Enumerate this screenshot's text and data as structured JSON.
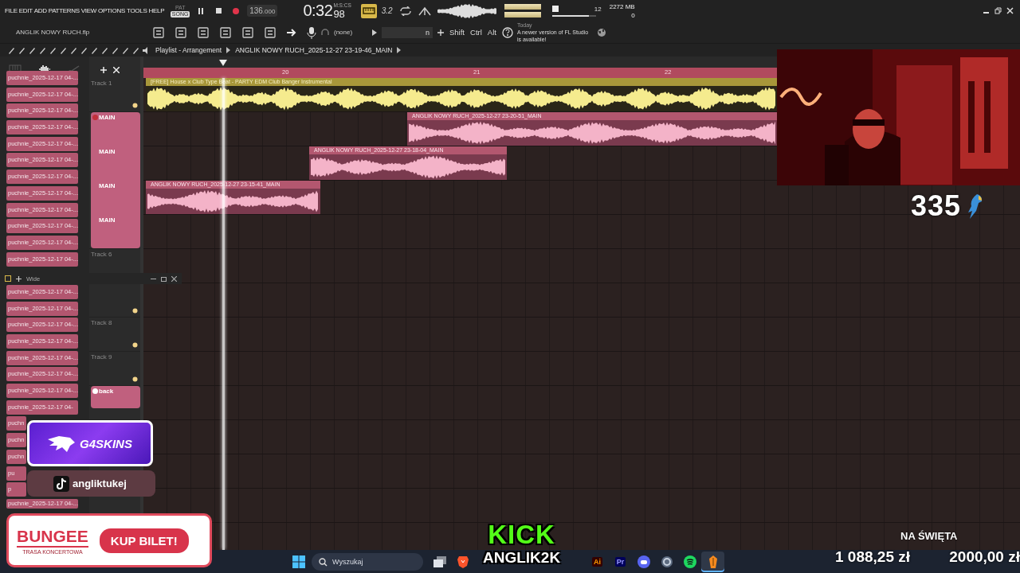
{
  "menu": [
    "FILE",
    "EDIT",
    "ADD",
    "PATTERNS",
    "VIEW",
    "OPTIONS",
    "TOOLS",
    "HELP"
  ],
  "mode_toggle": [
    {
      "label": "PAT",
      "selected": false
    },
    {
      "label": "SONG",
      "selected": true
    }
  ],
  "transport": {
    "recording": true,
    "tempo": "136",
    "tempo_fraction": ".000"
  },
  "time": {
    "unit": "M:S:CS",
    "value": "0:32",
    "fraction": "98"
  },
  "snap": "3.2",
  "monitor": {
    "voices": "12",
    "memory": "2272 MB",
    "polyphony": "0"
  },
  "master_volume": {
    "level": 0.85
  },
  "project_file": "ANGLIK NOWY RUCH.flp",
  "pattern_selector": "(none)",
  "name_field": "n",
  "modifier_keys": [
    "Shift",
    "Ctrl",
    "Alt"
  ],
  "news": {
    "label": "Today",
    "text": "A newer version of FL Studio is available!"
  },
  "playlist": {
    "title": "Playlist - Arrangement",
    "breadcrumb": "ANGLIK NOWY RUCH_2025-12-27 23-19-46_MAIN",
    "ruler": [
      "20",
      "21",
      "22"
    ]
  },
  "browser": {
    "tabs": [
      {
        "kind": "piano",
        "selected": false
      },
      {
        "kind": "audio",
        "selected": true
      },
      {
        "kind": "plugin",
        "selected": false
      }
    ],
    "items_top": [
      "puchnie_2025-12-17 04-...",
      "puchnie_2025-12-17 04-...",
      "puchnie_2025-12-17 04-...",
      "puchnie_2025-12-17 04-...",
      "puchnie_2025-12-17 04-...",
      "puchnie_2025-12-17 04-...",
      "puchnie_2025-12-17 04-...",
      "puchnie_2025-12-17 04-...",
      "puchnie_2025-12-17 04-...",
      "puchnie_2025-12-17 04-...",
      "puchnie_2025-12-17 04-...",
      "puchnie_2025-12-17 04-..."
    ],
    "items_bottom": [
      "puchnie_2025-12-17 04-...",
      "puchnie_2025-12-17 04-...",
      "puchnie_2025-12-17 04-...",
      "puchnie_2025-12-17 04-...",
      "puchnie_2025-12-17 04-...",
      "puchnie_2025-12-17 04-...",
      "puchnie_2025-12-17 04-...",
      "puchnie_2025-12-17 04-",
      "puchn",
      "puchn",
      "puchn",
      "pu",
      "p",
      "puchnie_2025-12-17 04-..."
    ]
  },
  "floating_window": {
    "title": "Wide"
  },
  "tracks": [
    {
      "kind": "track",
      "label": "Track 1"
    },
    {
      "kind": "group",
      "labels": [
        "MAIN",
        "MAIN",
        "MAIN",
        "MAIN"
      ]
    },
    {
      "kind": "covered",
      "label": "Track 6"
    },
    {
      "kind": "hidden"
    },
    {
      "kind": "track",
      "label": "Track 8"
    },
    {
      "kind": "track",
      "label": "Track 9"
    },
    {
      "kind": "audio",
      "label": "back"
    }
  ],
  "clips": [
    {
      "kind": "beat",
      "title": "[FREE] House x Club Type Beat - PARTY  EDM Club Banger Instrumental"
    },
    {
      "kind": "vocal",
      "title": "ANGLIK NOWY RUCH_2025-12-27 23-20-51_MAIN"
    },
    {
      "kind": "vocal",
      "title": "ANGLIK NOWY RUCH_2025-12-27 23-18-04_MAIN"
    },
    {
      "kind": "vocal",
      "title": "ANGLIK NOWY RUCH_2025-12-27 23-15-41_MAIN"
    }
  ],
  "overlays": {
    "viewer_count": "335",
    "sponsor": "G4SKINS",
    "tiktok": "angliktukej",
    "ad": {
      "brand": "BUNGEE",
      "subtitle": "TRASA KONCERTOWA",
      "button": "KUP BILET!"
    },
    "kick": {
      "logo": "KICK",
      "channel": "ANGLIK2K"
    },
    "goal": {
      "title": "NA ŚWIĘTA",
      "raised": "1 088,25 zł",
      "target": "2000,00 zł"
    }
  },
  "taskbar": {
    "search_placeholder": "Wyszukaj",
    "apps": [
      {
        "kind": "taskview",
        "selected": false
      },
      {
        "kind": "browser",
        "selected": false
      },
      {
        "kind": "ai",
        "label": "Ai",
        "selected": false
      },
      {
        "kind": "pr",
        "label": "Pr",
        "selected": false
      },
      {
        "kind": "chat",
        "selected": false
      },
      {
        "kind": "settings",
        "selected": false
      },
      {
        "kind": "music",
        "selected": false
      },
      {
        "kind": "daw",
        "selected": true
      }
    ]
  }
}
